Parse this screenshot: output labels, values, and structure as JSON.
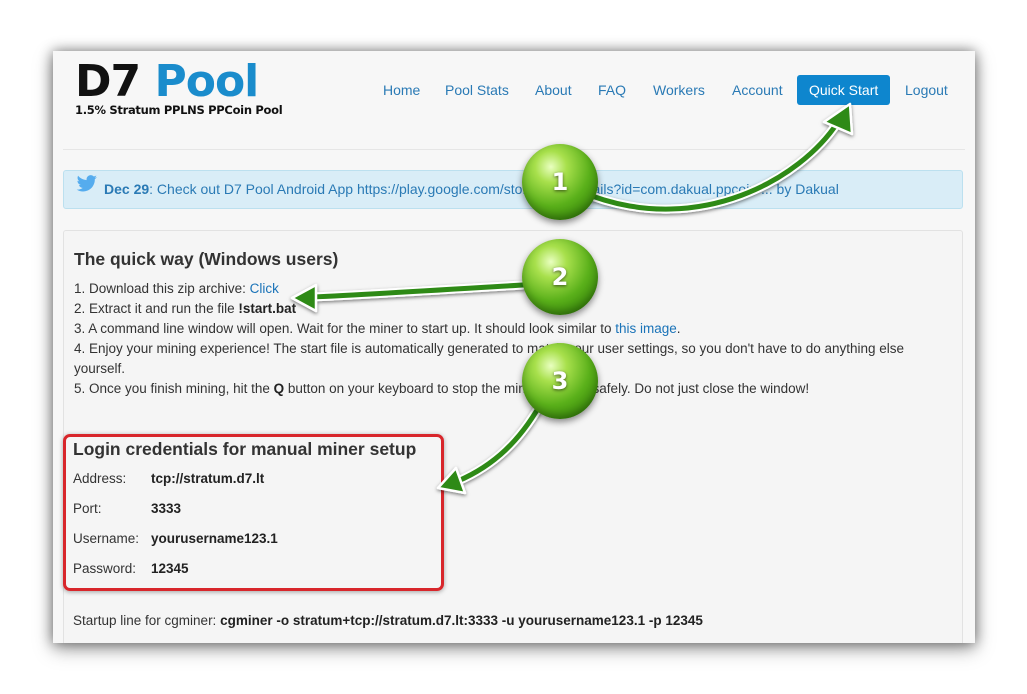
{
  "logo": {
    "d7": "D7",
    "pool": "Pool",
    "subtitle": "1.5% Stratum PPLNS PPCoin Pool"
  },
  "nav": [
    {
      "label": "Home"
    },
    {
      "label": "Pool Stats"
    },
    {
      "label": "About"
    },
    {
      "label": "FAQ"
    },
    {
      "label": "Workers"
    },
    {
      "label": "Account"
    },
    {
      "label": "Quick Start",
      "active": true
    },
    {
      "label": "Logout"
    }
  ],
  "alert": {
    "date": "Dec 29",
    "message": ": Check out D7 Pool Android App https://play.google.com/store/apps/details?id=com.dakual.ppcoin ... by Dakual",
    "icon": "twitter-bird-icon"
  },
  "quick": {
    "title": "The quick way (Windows users)",
    "step1_text": "1. Download this zip archive: ",
    "step1_link": "Click",
    "step2_text": "2. Extract it and run the file ",
    "step2_file": "!start.bat",
    "step3_text": "3. A command line window will open. Wait for the miner to start up. It should look similar to ",
    "step3_link": "this image",
    "step3_end": ".",
    "step4_line1": "4. Enjoy your mining experience! The start file is automatically generated to match your user settings, so you don't have to do anything else",
    "step4_line2": "yourself.",
    "step5_text": "5. Once you finish mining, hit the ",
    "step5_key": "Q",
    "step5_end": " button on your keyboard to stop the miner process safely. Do not just close the window!"
  },
  "credentials": {
    "title": "Login credentials for manual miner setup",
    "address_label": "Address:",
    "address_value": "tcp://stratum.d7.lt",
    "port_label": "Port:",
    "port_value": "3333",
    "username_label": "Username:",
    "username_value": "yourusername123.1",
    "password_label": "Password:",
    "password_value": "12345"
  },
  "startup": {
    "label": "Startup line for cgminer: ",
    "command": "cgminer -o stratum+tcp://stratum.d7.lt:3333 -u yourusername123.1 -p 12345"
  },
  "annotations": {
    "badge1": "1",
    "badge2": "2",
    "badge3": "3",
    "arrow_color": "#2e8a12",
    "box_color": "#d8262b"
  }
}
